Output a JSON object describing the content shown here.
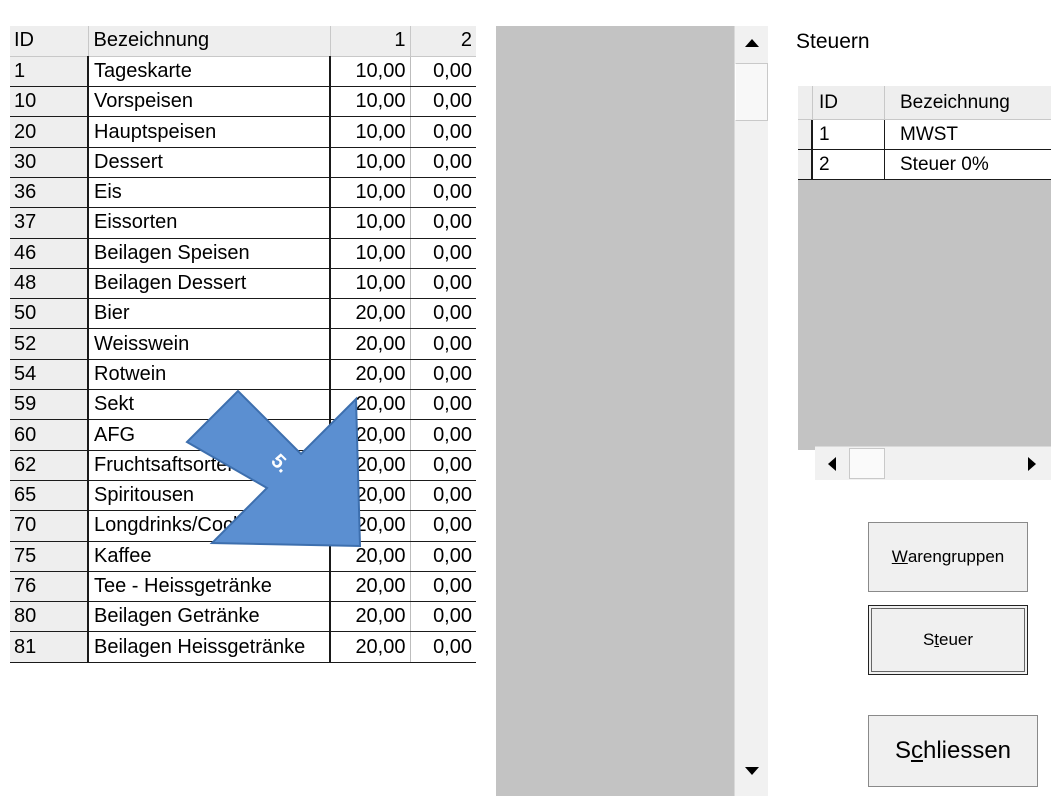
{
  "grid": {
    "columns": [
      "ID",
      "Bezeichnung",
      "1",
      "2"
    ],
    "rows": [
      [
        "1",
        "Tageskarte",
        "10,00",
        "0,00"
      ],
      [
        "10",
        "Vorspeisen",
        "10,00",
        "0,00"
      ],
      [
        "20",
        "Hauptspeisen",
        "10,00",
        "0,00"
      ],
      [
        "30",
        "Dessert",
        "10,00",
        "0,00"
      ],
      [
        "36",
        "Eis",
        "10,00",
        "0,00"
      ],
      [
        "37",
        "Eissorten",
        "10,00",
        "0,00"
      ],
      [
        "46",
        "Beilagen Speisen",
        "10,00",
        "0,00"
      ],
      [
        "48",
        "Beilagen Dessert",
        "10,00",
        "0,00"
      ],
      [
        "50",
        "Bier",
        "20,00",
        "0,00"
      ],
      [
        "52",
        "Weisswein",
        "20,00",
        "0,00"
      ],
      [
        "54",
        "Rotwein",
        "20,00",
        "0,00"
      ],
      [
        "59",
        "Sekt",
        "20,00",
        "0,00"
      ],
      [
        "60",
        "AFG",
        "20,00",
        "0,00"
      ],
      [
        "62",
        "Fruchtsaftsorten",
        "20,00",
        "0,00"
      ],
      [
        "65",
        "Spiritousen",
        "20,00",
        "0,00"
      ],
      [
        "70",
        "Longdrinks/Cocktails",
        "20,00",
        "0,00"
      ],
      [
        "75",
        "Kaffee",
        "20,00",
        "0,00"
      ],
      [
        "76",
        "Tee - Heissgetränke",
        "20,00",
        "0,00"
      ],
      [
        "80",
        "Beilagen Getränke",
        "20,00",
        "0,00"
      ],
      [
        "81",
        "Beilagen Heissgetränke",
        "20,00",
        "0,00"
      ]
    ]
  },
  "steuern": {
    "title": "Steuern",
    "columns": [
      "ID",
      "Bezeichnung"
    ],
    "rows": [
      [
        "1",
        "MWST"
      ],
      [
        "2",
        "Steuer 0%"
      ]
    ]
  },
  "buttons": {
    "warengruppen": {
      "mnemonic": "W",
      "rest": "arengruppen"
    },
    "steuer": {
      "pre": "S",
      "mnemonic": "t",
      "rest": "euer"
    },
    "schliessen": {
      "pre": "S",
      "mnemonic": "c",
      "rest": "hliessen"
    }
  },
  "annotation": {
    "label": "5.",
    "color": "#5b8fd1"
  }
}
